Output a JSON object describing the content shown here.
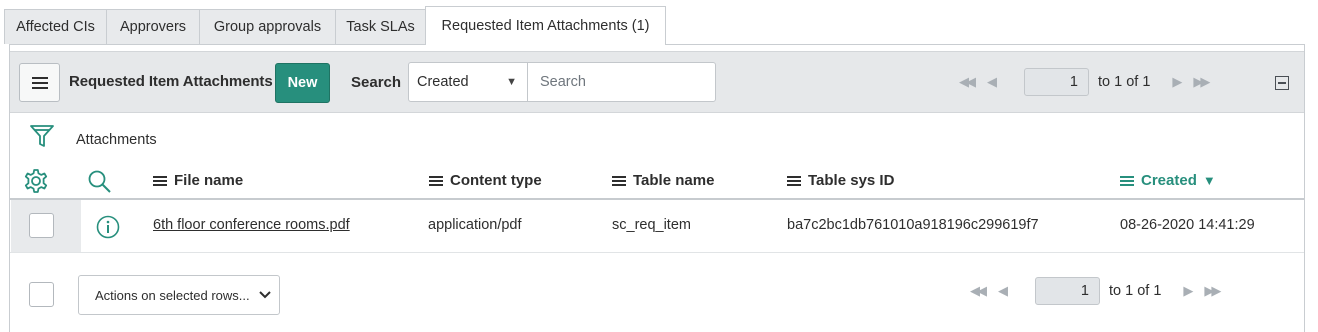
{
  "tabs": [
    {
      "label": "Affected CIs",
      "active": false
    },
    {
      "label": "Approvers",
      "active": false
    },
    {
      "label": "Group approvals",
      "active": false
    },
    {
      "label": "Task SLAs",
      "active": false
    },
    {
      "label": "Requested Item Attachments (1)",
      "active": true
    }
  ],
  "toolbar": {
    "menu_icon": "hamburger-menu-icon",
    "title": "Requested Item Attachments",
    "new_label": "New",
    "search_label": "Search",
    "search_field": "Created",
    "search_placeholder": "Search",
    "search_value": "",
    "pagination": {
      "current": "1",
      "range_text": "to 1 of 1"
    },
    "collapse_icon": "collapse-icon"
  },
  "filter": {
    "icon": "funnel-icon",
    "label": "Attachments"
  },
  "table": {
    "header_icons": [
      "gear-icon",
      "search-icon"
    ],
    "columns": [
      {
        "label": "File name",
        "sorted": false
      },
      {
        "label": "Content type",
        "sorted": false
      },
      {
        "label": "Table name",
        "sorted": false
      },
      {
        "label": "Table sys ID",
        "sorted": false
      },
      {
        "label": "Created",
        "sorted": true,
        "sort_direction": "descending"
      }
    ],
    "rows": [
      {
        "checked": false,
        "row_icon": "info-icon",
        "file_name": "6th floor conference rooms.pdf",
        "content_type": "application/pdf",
        "table_name": "sc_req_item",
        "table_sys_id": "ba7c2bc1db761010a918196c299619f7",
        "created": "08-26-2020 14:41:29"
      }
    ]
  },
  "footer": {
    "actions_label": "Actions on selected rows...",
    "pagination": {
      "current": "1",
      "range_text": "to 1 of 1"
    }
  },
  "colors": {
    "accent": "#278f7d",
    "toolbar_bg": "#e6e8ea",
    "tab_bg": "#e8eaec",
    "border": "#c9cdd1"
  }
}
